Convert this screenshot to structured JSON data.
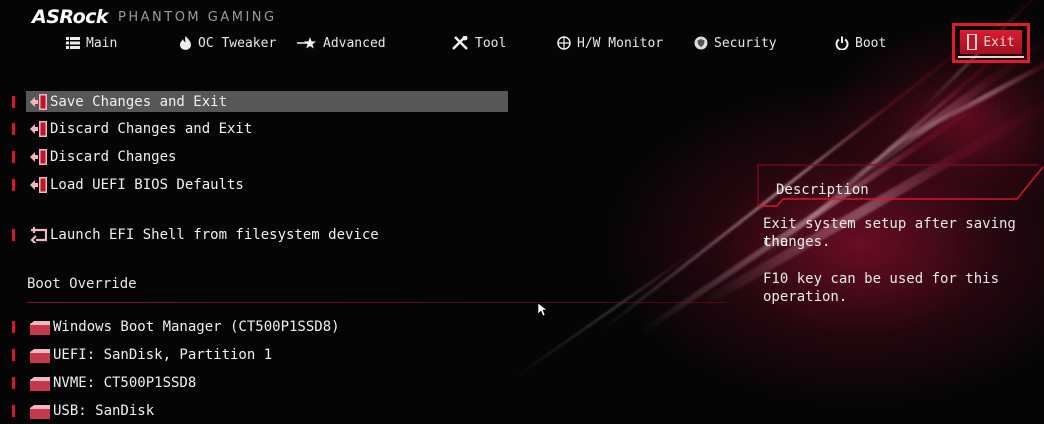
{
  "brand": {
    "logo": "ASRock",
    "subtitle": "PHANTOM GAMING"
  },
  "nav": {
    "items": [
      {
        "label": "Main",
        "icon": "list-icon"
      },
      {
        "label": "OC Tweaker",
        "icon": "flame-icon"
      },
      {
        "label": "Advanced",
        "icon": "star-arrow-icon"
      },
      {
        "label": "Tool",
        "icon": "tools-icon"
      },
      {
        "label": "H/W Monitor",
        "icon": "crosshair-icon"
      },
      {
        "label": "Security",
        "icon": "shield-icon"
      },
      {
        "label": "Boot",
        "icon": "power-icon"
      },
      {
        "label": "Exit",
        "icon": "exit-door-icon"
      }
    ],
    "active": "Exit"
  },
  "menu": {
    "items": [
      {
        "label": "Save Changes and Exit",
        "icon": "exit-door-icon",
        "selected": true
      },
      {
        "label": "Discard Changes and Exit",
        "icon": "exit-door-icon"
      },
      {
        "label": "Discard Changes",
        "icon": "exit-door-icon"
      },
      {
        "label": "Load UEFI BIOS Defaults",
        "icon": "exit-door-icon"
      },
      {
        "label": "Launch EFI Shell from filesystem device",
        "icon": "shell-icon"
      }
    ]
  },
  "boot_override": {
    "heading": "Boot Override",
    "items": [
      {
        "label": "Windows Boot Manager (CT500P1SSD8)",
        "icon": "drive-icon"
      },
      {
        "label": "UEFI: SanDisk, Partition 1",
        "icon": "drive-icon"
      },
      {
        "label": "NVME: CT500P1SSD8",
        "icon": "drive-icon"
      },
      {
        "label": "USB: SanDisk",
        "icon": "drive-icon"
      }
    ]
  },
  "description": {
    "title": "Description",
    "line1": "Exit system setup after saving the",
    "line2": "changes.",
    "line3": "F10 key can be used for this",
    "line4": "operation."
  },
  "colors": {
    "accent": "#d8152a",
    "selected_bg": "#575757",
    "background": "#050505"
  }
}
